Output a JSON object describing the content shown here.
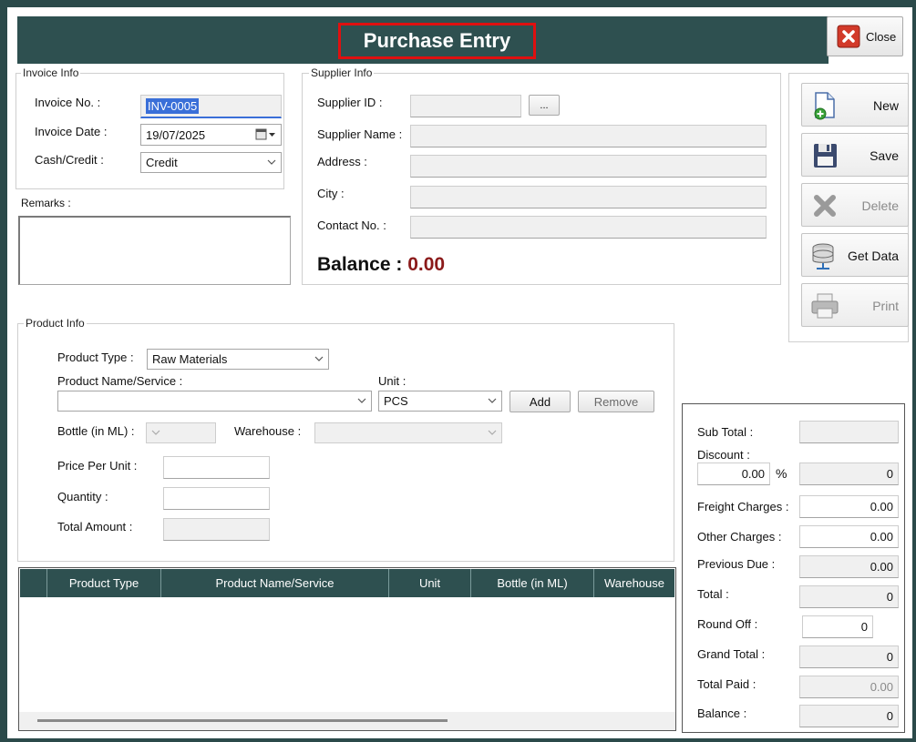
{
  "window": {
    "title": "Purchase Entry",
    "close_label": "Close"
  },
  "invoice_info": {
    "legend": "Invoice Info",
    "invoice_no_label": "Invoice No. :",
    "invoice_no_value": "INV-0005",
    "invoice_date_label": "Invoice Date :",
    "invoice_date_value": "19/07/2025",
    "cash_credit_label": "Cash/Credit :",
    "cash_credit_value": "Credit"
  },
  "remarks": {
    "label": "Remarks :"
  },
  "supplier_info": {
    "legend": "Supplier Info",
    "supplier_id_label": "Supplier ID :",
    "browse_label": "...",
    "supplier_name_label": "Supplier Name :",
    "address_label": "Address :",
    "city_label": "City :",
    "contact_label": "Contact No. :",
    "balance_label": "Balance :",
    "balance_value": "0.00",
    "balance_color": "#8b1a1a"
  },
  "actions": {
    "new_label": "New",
    "save_label": "Save",
    "delete_label": "Delete",
    "get_data_label": "Get Data",
    "print_label": "Print"
  },
  "product_info": {
    "legend": "Product Info",
    "product_type_label": "Product Type :",
    "product_type_value": "Raw Materials",
    "product_name_label": "Product Name/Service :",
    "unit_label": "Unit :",
    "unit_value": "PCS",
    "add_label": "Add",
    "remove_label": "Remove",
    "bottle_label": "Bottle (in ML) :",
    "warehouse_label": "Warehouse :",
    "price_label": "Price Per Unit :",
    "quantity_label": "Quantity :",
    "total_amount_label": "Total Amount :"
  },
  "grid": {
    "columns": [
      "Product Type",
      "Product Name/Service",
      "Unit",
      "Bottle (in ML)",
      "Warehouse"
    ]
  },
  "totals": {
    "sub_total_label": "Sub Total :",
    "discount_label": "Discount :",
    "discount_pct": "0.00",
    "pct_sign": "%",
    "discount_amount": "0",
    "freight_label": "Freight Charges :",
    "freight_value": "0.00",
    "other_label": "Other Charges :",
    "other_value": "0.00",
    "prev_due_label": "Previous Due :",
    "prev_due_value": "0.00",
    "total_label": "Total :",
    "total_value": "0",
    "round_off_label": "Round Off :",
    "round_off_value": "0",
    "grand_total_label": "Grand Total :",
    "grand_total_value": "0",
    "total_paid_label": "Total Paid :",
    "total_paid_value": "0.00",
    "balance_label": "Balance :",
    "balance_value": "0"
  },
  "colors": {
    "header": "#2e5050",
    "highlight_border": "#e01010",
    "selection": "#3a6fd8"
  }
}
